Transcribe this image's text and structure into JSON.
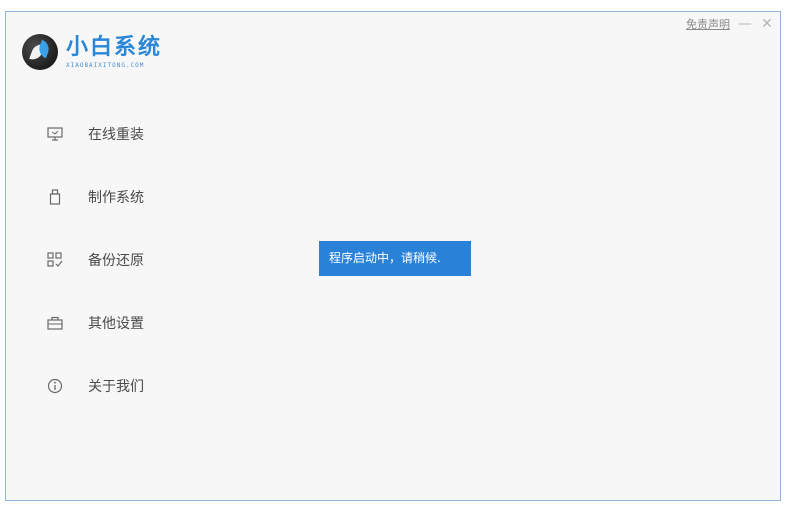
{
  "window": {
    "disclaimer": "免责声明",
    "minimize_glyph": "—",
    "close_glyph": "✕"
  },
  "logo": {
    "title": "小白系统",
    "subtitle": "XIAOBAIXITONG.COM"
  },
  "sidebar": {
    "items": [
      {
        "label": "在线重装",
        "icon": "monitor-icon"
      },
      {
        "label": "制作系统",
        "icon": "usb-drive-icon"
      },
      {
        "label": "备份还原",
        "icon": "grid-backup-icon"
      },
      {
        "label": "其他设置",
        "icon": "briefcase-icon"
      },
      {
        "label": "关于我们",
        "icon": "info-icon"
      }
    ]
  },
  "toast": {
    "message": "程序启动中，请稍候."
  },
  "colors": {
    "accent": "#2a82d8",
    "border": "#8fb3d9",
    "background": "#f7f7f7",
    "text": "#4a4a4a"
  }
}
